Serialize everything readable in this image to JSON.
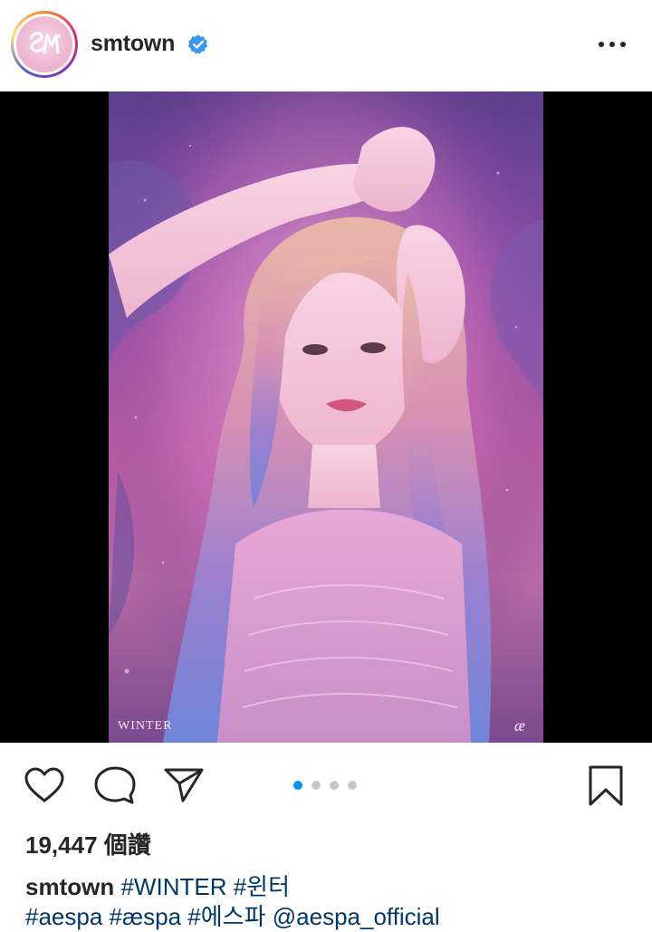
{
  "post": {
    "username": "smtown",
    "verified": true,
    "more_icon": "more-horizontal-icon",
    "avatar_icon": "sm-logo-icon"
  },
  "media": {
    "caption": "WINTER",
    "logo": "æ",
    "carousel": {
      "total": 4,
      "current": 1
    }
  },
  "actions": {
    "like_icon": "heart-outline-icon",
    "comment_icon": "comment-bubble-icon",
    "share_icon": "send-paper-plane-icon",
    "save_icon": "bookmark-outline-icon"
  },
  "likes": "19,447 個讚",
  "caption": {
    "username": "smtown",
    "line1": [
      "#WINTER",
      "#윈터"
    ],
    "line2": [
      "#aespa",
      "#æspa",
      "#에스파",
      "@aespa_official"
    ]
  },
  "colors": {
    "accent_blue": "#0095f6",
    "verified_blue": "#3897f0",
    "link_color": "#00376b",
    "text": "#262626",
    "media_bg": "#000000"
  }
}
